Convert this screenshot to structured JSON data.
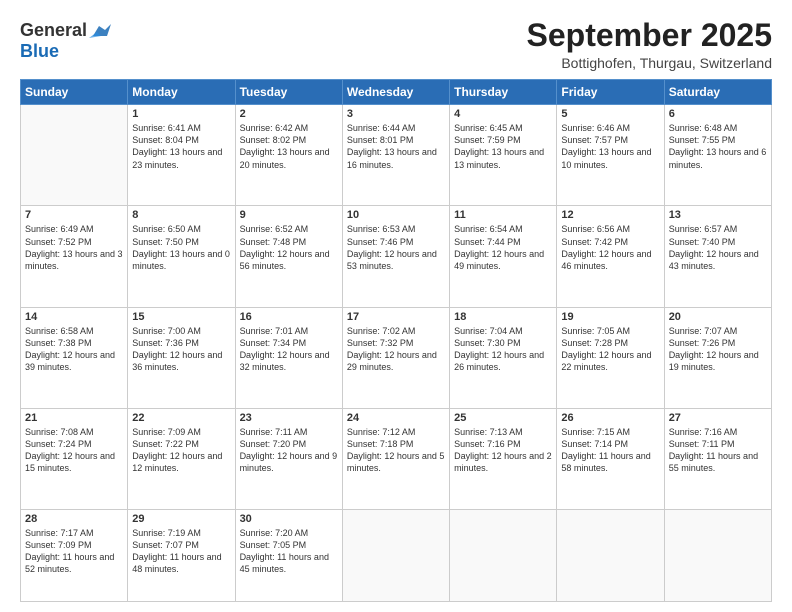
{
  "logo": {
    "general": "General",
    "blue": "Blue"
  },
  "title": "September 2025",
  "location": "Bottighofen, Thurgau, Switzerland",
  "weekdays": [
    "Sunday",
    "Monday",
    "Tuesday",
    "Wednesday",
    "Thursday",
    "Friday",
    "Saturday"
  ],
  "weeks": [
    [
      {
        "day": "",
        "info": ""
      },
      {
        "day": "1",
        "info": "Sunrise: 6:41 AM\nSunset: 8:04 PM\nDaylight: 13 hours\nand 23 minutes."
      },
      {
        "day": "2",
        "info": "Sunrise: 6:42 AM\nSunset: 8:02 PM\nDaylight: 13 hours\nand 20 minutes."
      },
      {
        "day": "3",
        "info": "Sunrise: 6:44 AM\nSunset: 8:01 PM\nDaylight: 13 hours\nand 16 minutes."
      },
      {
        "day": "4",
        "info": "Sunrise: 6:45 AM\nSunset: 7:59 PM\nDaylight: 13 hours\nand 13 minutes."
      },
      {
        "day": "5",
        "info": "Sunrise: 6:46 AM\nSunset: 7:57 PM\nDaylight: 13 hours\nand 10 minutes."
      },
      {
        "day": "6",
        "info": "Sunrise: 6:48 AM\nSunset: 7:55 PM\nDaylight: 13 hours\nand 6 minutes."
      }
    ],
    [
      {
        "day": "7",
        "info": "Sunrise: 6:49 AM\nSunset: 7:52 PM\nDaylight: 13 hours\nand 3 minutes."
      },
      {
        "day": "8",
        "info": "Sunrise: 6:50 AM\nSunset: 7:50 PM\nDaylight: 13 hours\nand 0 minutes."
      },
      {
        "day": "9",
        "info": "Sunrise: 6:52 AM\nSunset: 7:48 PM\nDaylight: 12 hours\nand 56 minutes."
      },
      {
        "day": "10",
        "info": "Sunrise: 6:53 AM\nSunset: 7:46 PM\nDaylight: 12 hours\nand 53 minutes."
      },
      {
        "day": "11",
        "info": "Sunrise: 6:54 AM\nSunset: 7:44 PM\nDaylight: 12 hours\nand 49 minutes."
      },
      {
        "day": "12",
        "info": "Sunrise: 6:56 AM\nSunset: 7:42 PM\nDaylight: 12 hours\nand 46 minutes."
      },
      {
        "day": "13",
        "info": "Sunrise: 6:57 AM\nSunset: 7:40 PM\nDaylight: 12 hours\nand 43 minutes."
      }
    ],
    [
      {
        "day": "14",
        "info": "Sunrise: 6:58 AM\nSunset: 7:38 PM\nDaylight: 12 hours\nand 39 minutes."
      },
      {
        "day": "15",
        "info": "Sunrise: 7:00 AM\nSunset: 7:36 PM\nDaylight: 12 hours\nand 36 minutes."
      },
      {
        "day": "16",
        "info": "Sunrise: 7:01 AM\nSunset: 7:34 PM\nDaylight: 12 hours\nand 32 minutes."
      },
      {
        "day": "17",
        "info": "Sunrise: 7:02 AM\nSunset: 7:32 PM\nDaylight: 12 hours\nand 29 minutes."
      },
      {
        "day": "18",
        "info": "Sunrise: 7:04 AM\nSunset: 7:30 PM\nDaylight: 12 hours\nand 26 minutes."
      },
      {
        "day": "19",
        "info": "Sunrise: 7:05 AM\nSunset: 7:28 PM\nDaylight: 12 hours\nand 22 minutes."
      },
      {
        "day": "20",
        "info": "Sunrise: 7:07 AM\nSunset: 7:26 PM\nDaylight: 12 hours\nand 19 minutes."
      }
    ],
    [
      {
        "day": "21",
        "info": "Sunrise: 7:08 AM\nSunset: 7:24 PM\nDaylight: 12 hours\nand 15 minutes."
      },
      {
        "day": "22",
        "info": "Sunrise: 7:09 AM\nSunset: 7:22 PM\nDaylight: 12 hours\nand 12 minutes."
      },
      {
        "day": "23",
        "info": "Sunrise: 7:11 AM\nSunset: 7:20 PM\nDaylight: 12 hours\nand 9 minutes."
      },
      {
        "day": "24",
        "info": "Sunrise: 7:12 AM\nSunset: 7:18 PM\nDaylight: 12 hours\nand 5 minutes."
      },
      {
        "day": "25",
        "info": "Sunrise: 7:13 AM\nSunset: 7:16 PM\nDaylight: 12 hours\nand 2 minutes."
      },
      {
        "day": "26",
        "info": "Sunrise: 7:15 AM\nSunset: 7:14 PM\nDaylight: 11 hours\nand 58 minutes."
      },
      {
        "day": "27",
        "info": "Sunrise: 7:16 AM\nSunset: 7:11 PM\nDaylight: 11 hours\nand 55 minutes."
      }
    ],
    [
      {
        "day": "28",
        "info": "Sunrise: 7:17 AM\nSunset: 7:09 PM\nDaylight: 11 hours\nand 52 minutes."
      },
      {
        "day": "29",
        "info": "Sunrise: 7:19 AM\nSunset: 7:07 PM\nDaylight: 11 hours\nand 48 minutes."
      },
      {
        "day": "30",
        "info": "Sunrise: 7:20 AM\nSunset: 7:05 PM\nDaylight: 11 hours\nand 45 minutes."
      },
      {
        "day": "",
        "info": ""
      },
      {
        "day": "",
        "info": ""
      },
      {
        "day": "",
        "info": ""
      },
      {
        "day": "",
        "info": ""
      }
    ]
  ]
}
